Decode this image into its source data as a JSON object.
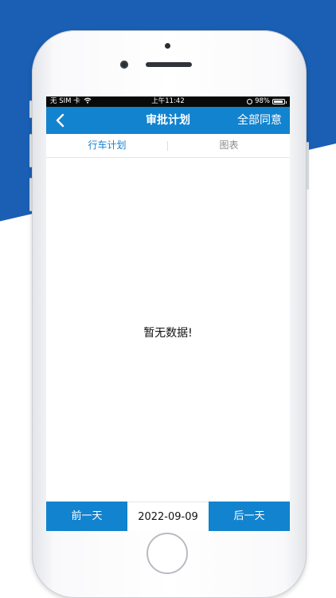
{
  "status_bar": {
    "carrier": "无 SIM 卡",
    "time": "上午11:42",
    "battery": "98%"
  },
  "nav": {
    "title": "审批计划",
    "action": "全部同意",
    "back_icon": "chevron-left-icon"
  },
  "tabs": [
    {
      "label": "行车计划",
      "active": true
    },
    {
      "label": "图表",
      "active": false
    }
  ],
  "empty_message": "暂无数据!",
  "bottom_bar": {
    "prev_label": "前一天",
    "date": "2022-09-09",
    "next_label": "后一天"
  },
  "colors": {
    "brand_blue": "#1283cf",
    "background_blue": "#1a5fb4"
  }
}
